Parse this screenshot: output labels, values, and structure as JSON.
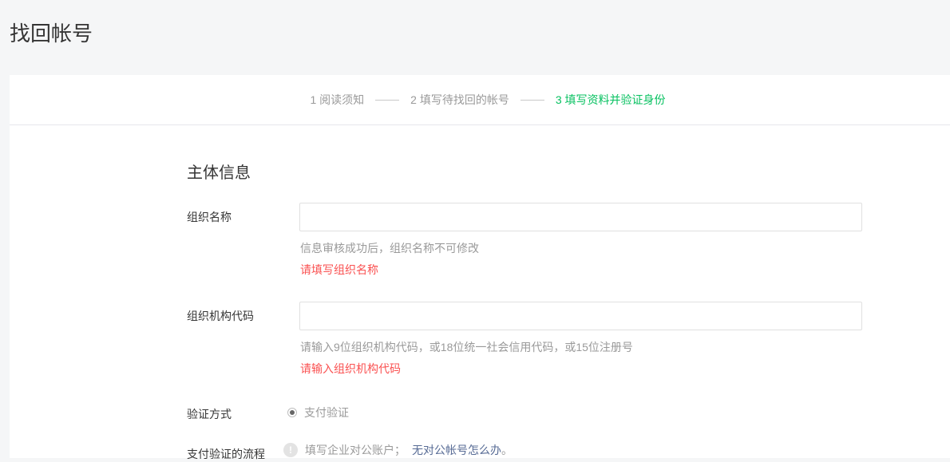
{
  "page": {
    "title": "找回帐号"
  },
  "steps": [
    {
      "label": "1 阅读须知"
    },
    {
      "label": "2 填写待找回的帐号"
    },
    {
      "label": "3 填写资料并验证身份"
    }
  ],
  "colors": {
    "active_step": "#07c160",
    "error": "#fa5151",
    "link": "#576b95"
  },
  "section": {
    "title": "主体信息"
  },
  "org_name": {
    "label": "组织名称",
    "value": "",
    "hint": "信息审核成功后，组织名称不可修改",
    "error": "请填写组织名称"
  },
  "org_code": {
    "label": "组织机构代码",
    "value": "",
    "hint": "请输入9位组织机构代码，或18位统一社会信用代码，或15位注册号",
    "error": "请输入组织机构代码"
  },
  "verify": {
    "label": "验证方式",
    "option": "支付验证",
    "selected": true
  },
  "payment_flow": {
    "label": "支付验证的流程",
    "info_icon": "info-icon",
    "text": "填写企业对公账户；",
    "link": "无对公帐号怎么办",
    "suffix": "。"
  }
}
